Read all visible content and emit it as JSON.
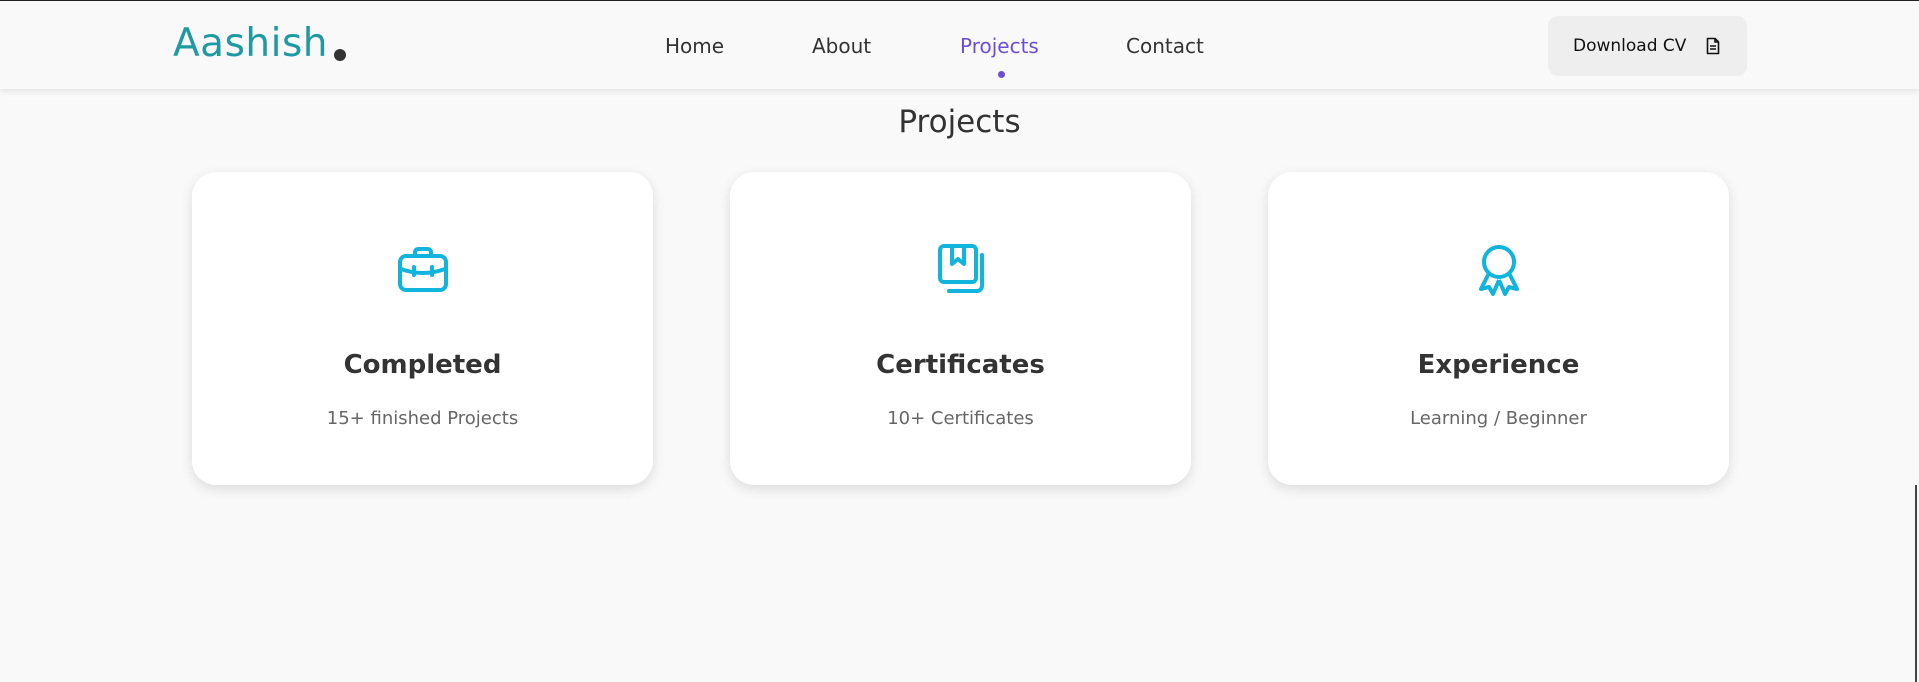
{
  "header": {
    "logo": "Aashish",
    "nav": [
      {
        "label": "Home"
      },
      {
        "label": "About"
      },
      {
        "label": "Projects",
        "active": true
      },
      {
        "label": "Contact"
      }
    ],
    "cv_button": "Download CV"
  },
  "section": {
    "title": "Projects",
    "cards": [
      {
        "icon": "briefcase-icon",
        "title": "Completed",
        "subtitle": "15+ finished Projects"
      },
      {
        "icon": "certificate-icon",
        "title": "Certificates",
        "subtitle": "10+ Certificates"
      },
      {
        "icon": "award-icon",
        "title": "Experience",
        "subtitle": "Learning / Beginner"
      }
    ]
  },
  "colors": {
    "logo": "#1f9aa3",
    "accent": "#6c4fd1",
    "icon": "#11b4dc",
    "text": "#333333"
  }
}
